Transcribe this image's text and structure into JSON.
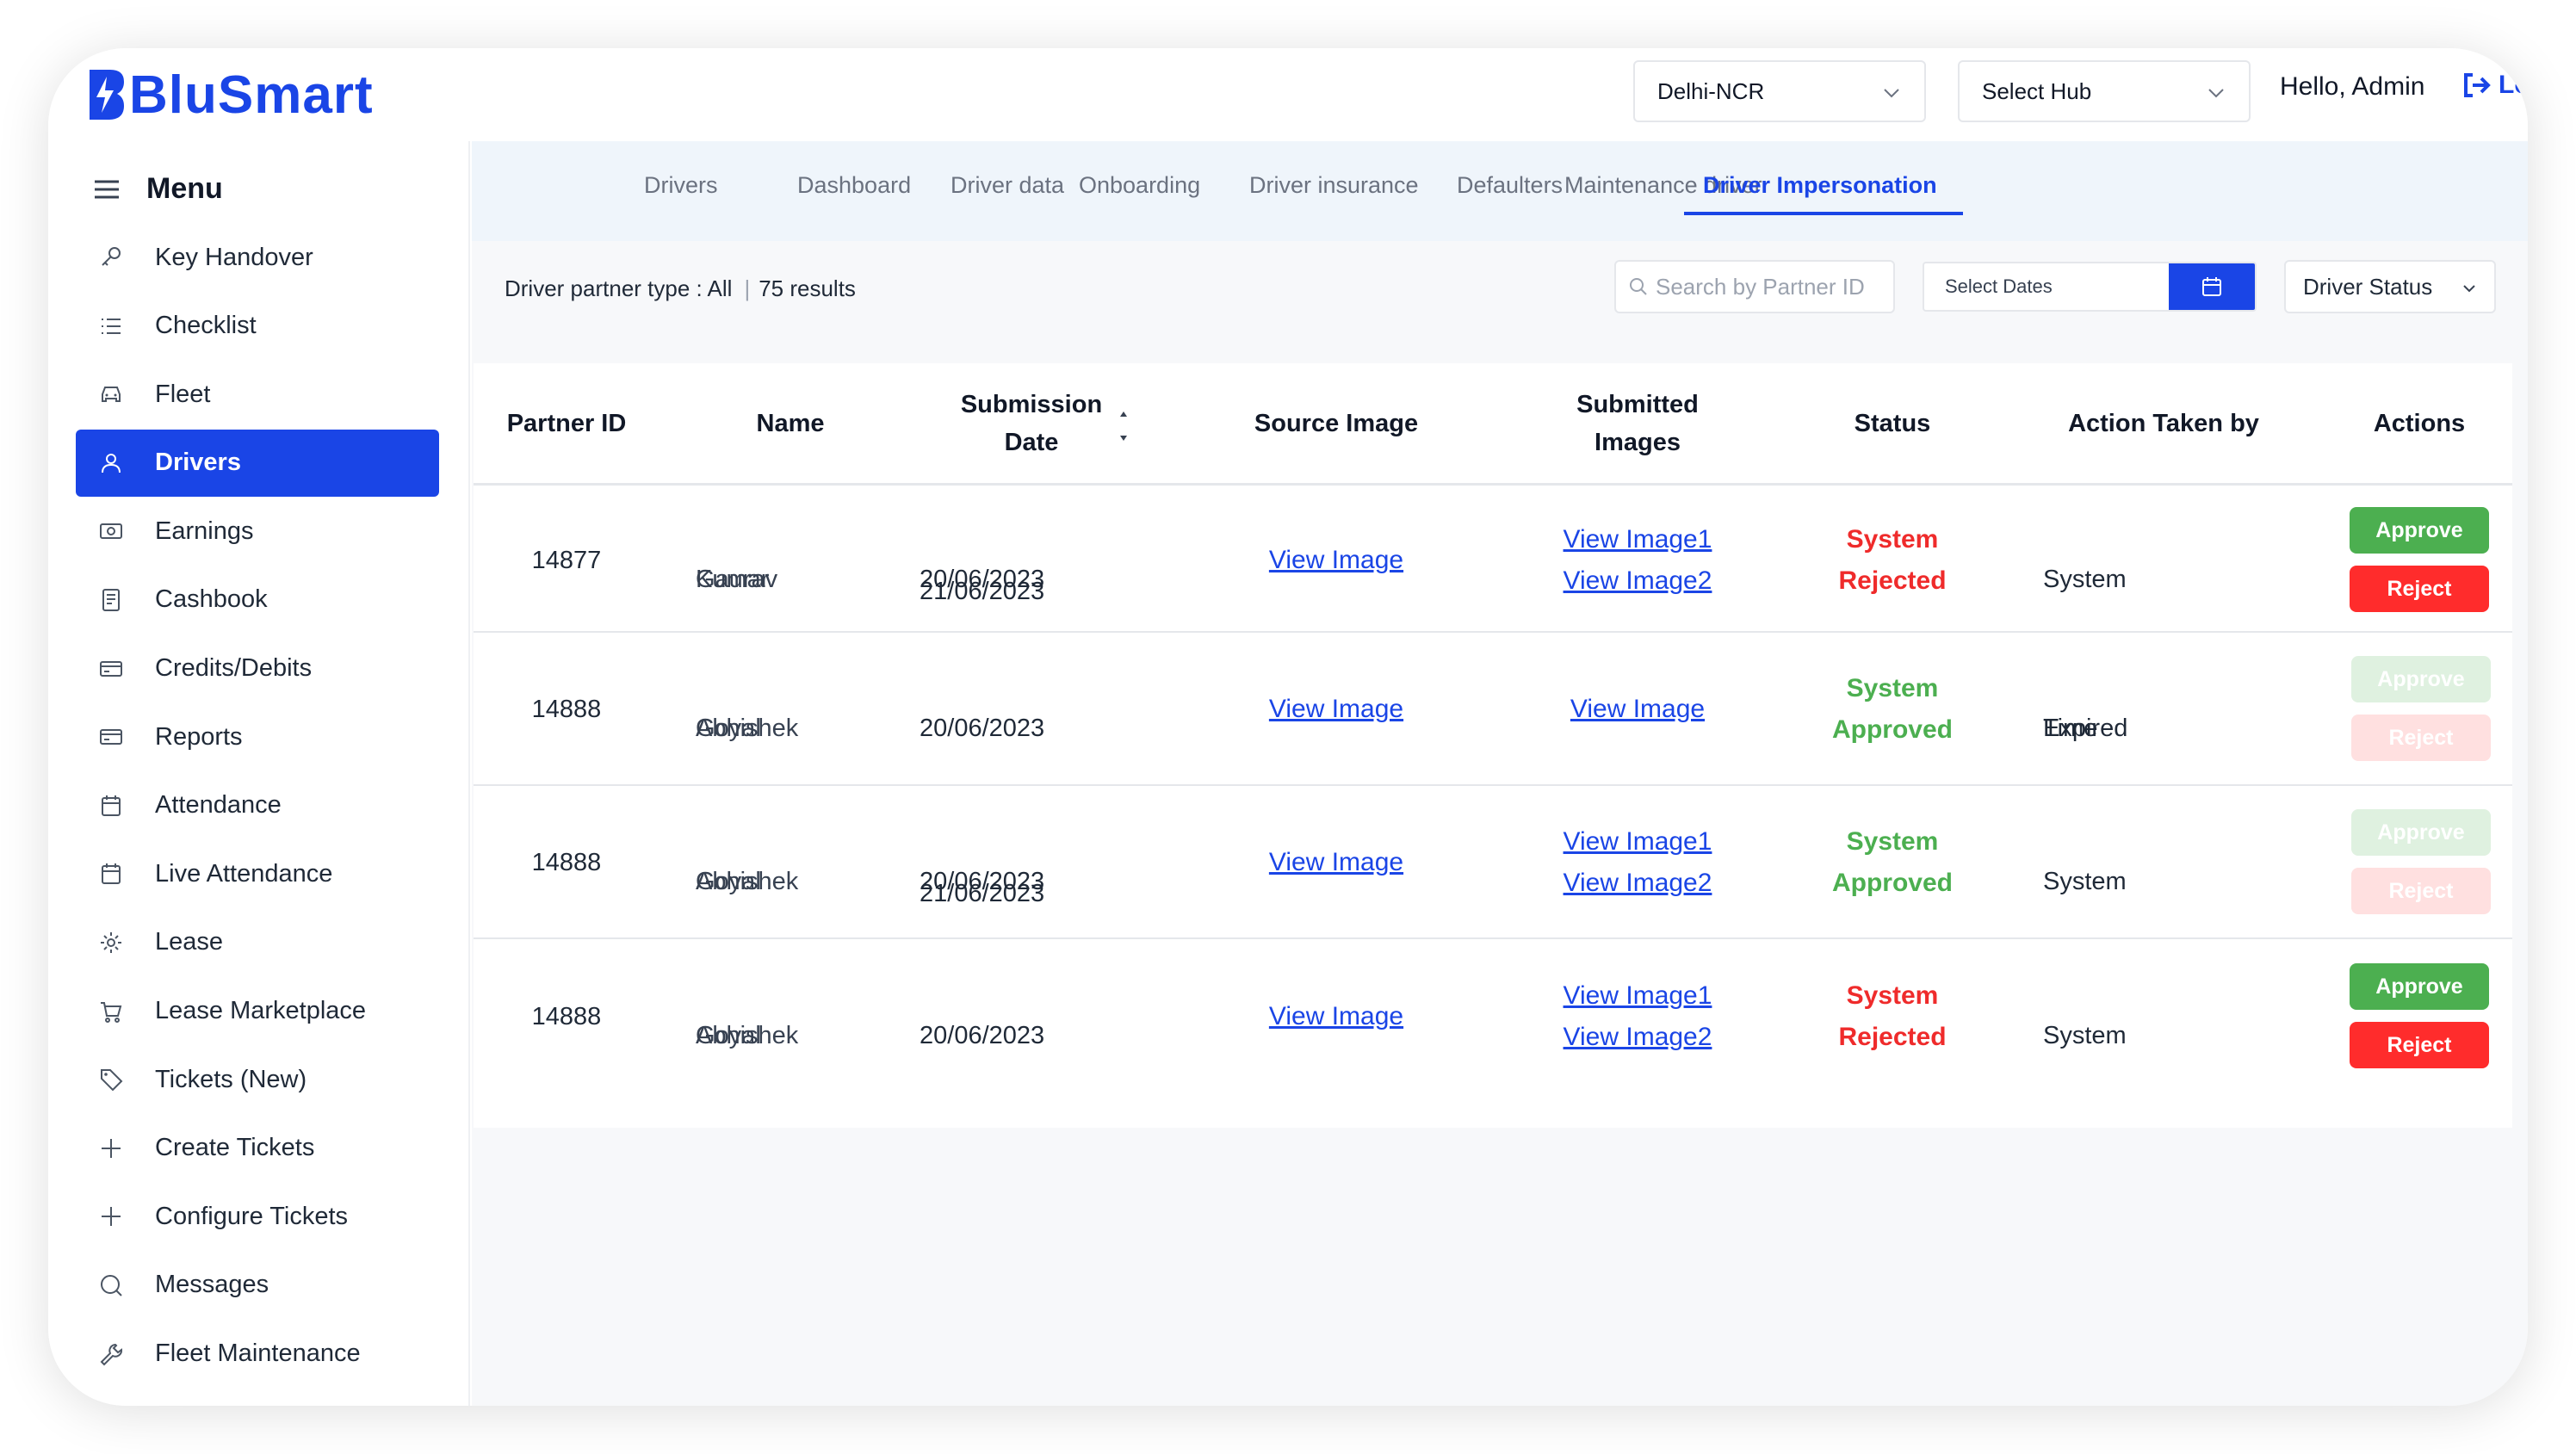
{
  "header": {
    "brand": "BluSmart",
    "city": "Delhi-NCR",
    "hub": "Select Hub",
    "greeting": "Hello, Admin",
    "logout": "Lo"
  },
  "sidebar": {
    "menu_title": "Menu",
    "items": [
      {
        "label": "Key Handover",
        "icon": "key-icon"
      },
      {
        "label": "Checklist",
        "icon": "list-icon"
      },
      {
        "label": "Fleet",
        "icon": "car-icon"
      },
      {
        "label": "Drivers",
        "icon": "user-icon"
      },
      {
        "label": "Earnings",
        "icon": "money-icon"
      },
      {
        "label": "Cashbook",
        "icon": "book-icon"
      },
      {
        "label": "Credits/Debits",
        "icon": "card-icon"
      },
      {
        "label": "Reports",
        "icon": "card-icon"
      },
      {
        "label": "Attendance",
        "icon": "calendar-icon"
      },
      {
        "label": "Live Attendance",
        "icon": "calendar-icon"
      },
      {
        "label": "Lease",
        "icon": "gear-icon"
      },
      {
        "label": "Lease Marketplace",
        "icon": "cart-icon"
      },
      {
        "label": "Tickets (New)",
        "icon": "tag-icon"
      },
      {
        "label": "Create Tickets",
        "icon": "plus-icon"
      },
      {
        "label": "Configure Tickets",
        "icon": "plus-icon"
      },
      {
        "label": "Messages",
        "icon": "chat-icon"
      },
      {
        "label": "Fleet Maintenance",
        "icon": "wrench-icon"
      }
    ],
    "active_index": 3
  },
  "tabs": [
    "Drivers",
    "Dashboard",
    "Driver data",
    "Onboarding",
    "Driver insurance",
    "Defaulters",
    "Maintenance driver",
    "Driver Impersonation"
  ],
  "active_tab": "Driver Impersonation",
  "filters": {
    "partner_type": "Driver partner type : All",
    "results": "75 results",
    "search_placeholder": "Search by Partner ID",
    "dates_label": "Select Dates",
    "status_label": "Driver Status"
  },
  "table": {
    "columns": [
      "Partner ID",
      "Name",
      "Submission Date",
      "Source Image",
      "Submitted Images",
      "Status",
      "Action Taken by",
      "Actions"
    ],
    "rows": [
      {
        "partner_id": "14877",
        "name": [
          "Gaurav",
          "Kumar"
        ],
        "dates": [
          "20/06/2023",
          "21/06/2023"
        ],
        "source_image": "View Image",
        "submitted_images": [
          "View Image1",
          "View Image2"
        ],
        "status": [
          "System",
          "Rejected"
        ],
        "status_type": "rejected",
        "action_by": [
          "System"
        ],
        "approve": "Approve",
        "reject": "Reject",
        "actions_enabled": true
      },
      {
        "partner_id": "14888",
        "name": [
          "Abhishek",
          "Goyal"
        ],
        "dates": [
          "20/06/2023"
        ],
        "source_image": "View Image",
        "submitted_images": [
          "View Image"
        ],
        "status": [
          "System",
          "Approved"
        ],
        "status_type": "approved",
        "action_by": [
          "Time",
          "Expired"
        ],
        "approve": "Approve",
        "reject": "Reject",
        "actions_enabled": false
      },
      {
        "partner_id": "14888",
        "name": [
          "Abhishek",
          "Goyal"
        ],
        "dates": [
          "20/06/2023",
          "21/06/2023"
        ],
        "source_image": "View Image",
        "submitted_images": [
          "View Image1",
          "View Image2"
        ],
        "status": [
          "System",
          "Approved"
        ],
        "status_type": "approved",
        "action_by": [
          "System"
        ],
        "approve": "Approve",
        "reject": "Reject",
        "actions_enabled": false
      },
      {
        "partner_id": "14888",
        "name": [
          "Abhishek",
          "Goyal"
        ],
        "dates": [
          "20/06/2023"
        ],
        "source_image": "View Image",
        "submitted_images": [
          "View Image1",
          "View Image2"
        ],
        "status": [
          "System",
          "Rejected"
        ],
        "status_type": "rejected",
        "action_by": [
          "System"
        ],
        "approve": "Approve",
        "reject": "Reject",
        "actions_enabled": true
      }
    ]
  },
  "colors": {
    "brand": "#1a45e6",
    "approve": "#4caf50",
    "reject": "#ff2c2c",
    "status_rejected": "#ef2b2b",
    "status_approved": "#4caf50"
  }
}
